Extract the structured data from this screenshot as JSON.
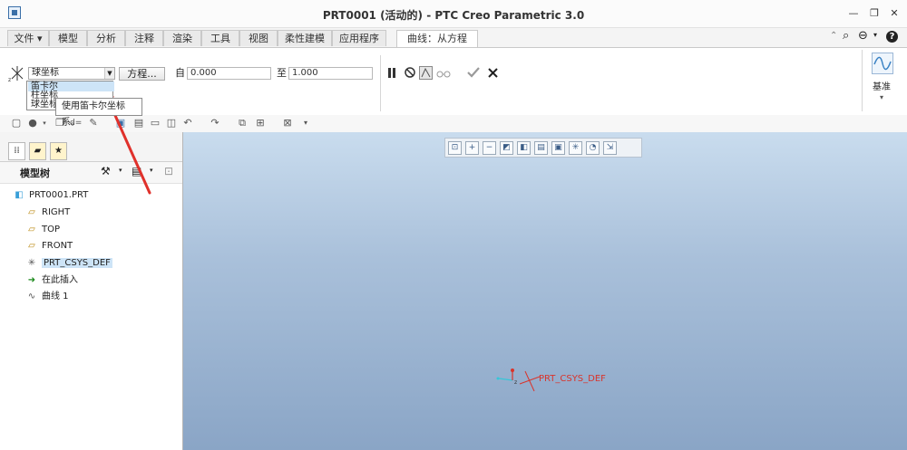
{
  "window": {
    "title": "PRT0001 (活动的) - PTC Creo Parametric 3.0",
    "minimize": "—",
    "restore": "❐",
    "close": "✕"
  },
  "tabs": [
    {
      "label": "文件 ▾"
    },
    {
      "label": "模型"
    },
    {
      "label": "分析"
    },
    {
      "label": "注释"
    },
    {
      "label": "渲染"
    },
    {
      "label": "工具"
    },
    {
      "label": "视图"
    },
    {
      "label": "柔性建模"
    },
    {
      "label": "应用程序"
    },
    {
      "label": "曲线：从方程"
    }
  ],
  "ribbon": {
    "csys_combo_value": "球坐标",
    "equation_button": "方程...",
    "from_label": "自",
    "from_value": "0.000",
    "to_label": "至",
    "to_value": "1.000",
    "datum_label": "基准"
  },
  "dropdown": {
    "options": [
      "笛卡尔",
      "柱坐标",
      "球坐标"
    ],
    "selected_index": 0,
    "tooltip": "使用笛卡尔坐标系。"
  },
  "model_tree": {
    "header": "模型树",
    "items": [
      {
        "label": "PRT0001.PRT",
        "icon": "part-icon"
      },
      {
        "label": "RIGHT",
        "icon": "datum-plane-icon"
      },
      {
        "label": "TOP",
        "icon": "datum-plane-icon"
      },
      {
        "label": "FRONT",
        "icon": "datum-plane-icon"
      },
      {
        "label": "PRT_CSYS_DEF",
        "icon": "csys-icon"
      },
      {
        "label": "在此插入",
        "icon": "insert-arrow-icon"
      },
      {
        "label": "曲线 1",
        "icon": "curve-icon"
      }
    ]
  },
  "viewport": {
    "csys_label": "PRT_CSYS_DEF"
  },
  "colors": {
    "accent": "#3a6fa8",
    "highlight": "#cde4f7",
    "annotation_arrow": "#e0312b",
    "csys_red": "#d9342b",
    "csys_cyan": "#37c6d8"
  }
}
